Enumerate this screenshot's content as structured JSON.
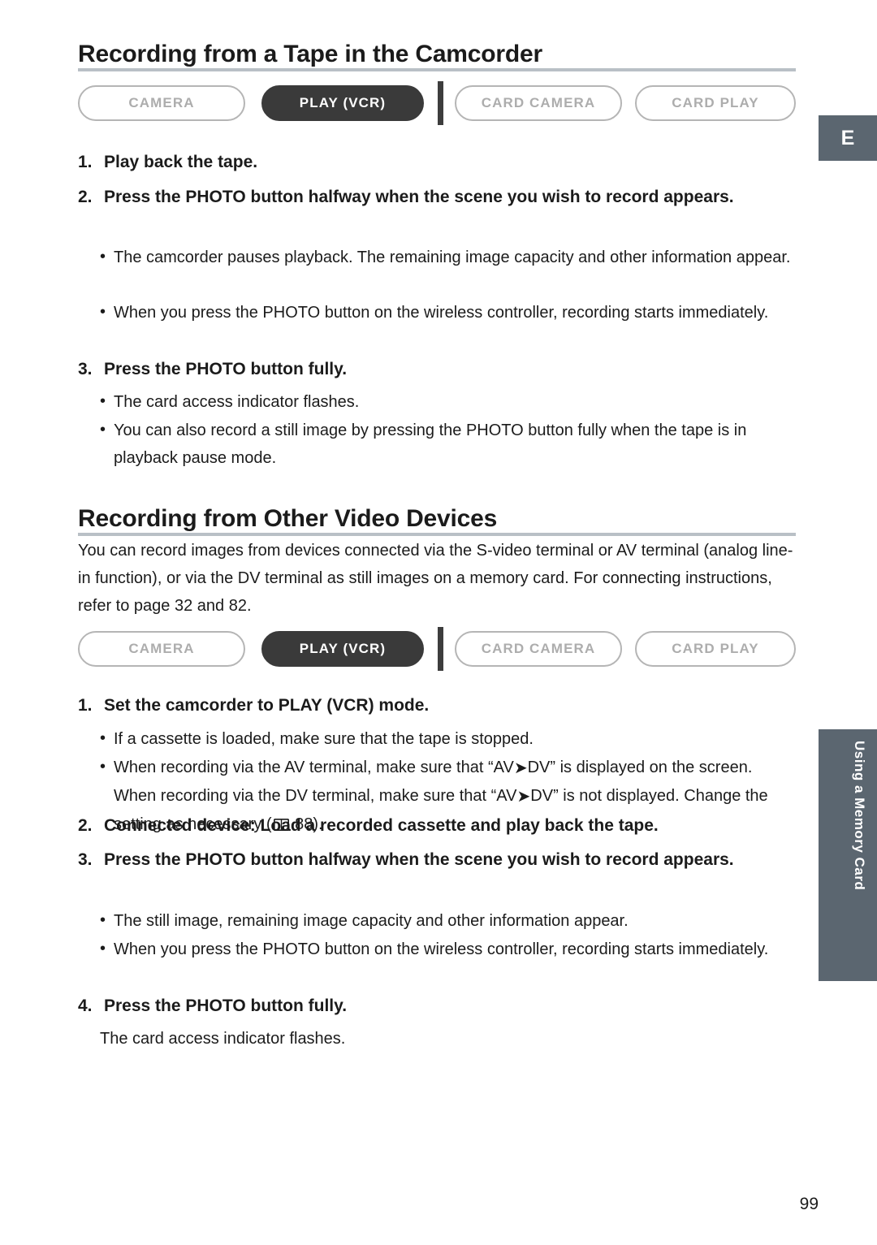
{
  "page": {
    "number": "99",
    "lang_tab": "E",
    "chapter_tab": "Using a Memory Card"
  },
  "section1": {
    "title": "Recording from a Tape in the Camcorder",
    "modes": [
      {
        "label": "CAMERA",
        "state": "inactive"
      },
      {
        "label": "PLAY (VCR)",
        "state": "active"
      },
      {
        "label": "CARD CAMERA",
        "state": "inactive"
      },
      {
        "label": "CARD PLAY",
        "state": "inactive"
      }
    ],
    "steps": [
      {
        "num": "1.",
        "text": "Play back the tape."
      },
      {
        "num": "2.",
        "text": "Press the PHOTO button halfway when the scene you wish to record appears."
      },
      {
        "num": "3.",
        "text": "Press the PHOTO button fully."
      }
    ],
    "bullets_after_step2": [
      "The camcorder pauses playback. The remaining image capacity and other information appear.",
      "When you press the PHOTO button on the wireless controller, recording starts immediately."
    ],
    "bullets_after_step3": [
      "The card access indicator flashes.",
      "You can also record a still image by pressing the PHOTO button fully when the tape is in playback pause mode."
    ]
  },
  "section2": {
    "title": "Recording from Other Video Devices",
    "intro": "You can record images from devices connected via the S-video terminal or AV terminal (analog line-in function), or via the DV terminal as still images on a memory card. For connecting instructions, refer to page 32 and 82.",
    "modes": [
      {
        "label": "CAMERA",
        "state": "inactive"
      },
      {
        "label": "PLAY (VCR)",
        "state": "active"
      },
      {
        "label": "CARD CAMERA",
        "state": "inactive"
      },
      {
        "label": "CARD PLAY",
        "state": "inactive"
      }
    ],
    "steps": [
      {
        "num": "1.",
        "text": "Set the camcorder to PLAY (VCR) mode."
      },
      {
        "num": "2.",
        "text": "Connected device: Load a recorded cassette and play back the tape."
      },
      {
        "num": "3.",
        "text": "Press the PHOTO button halfway when the scene you wish to record appears."
      },
      {
        "num": "4.",
        "text": "Press the PHOTO button fully."
      }
    ],
    "bullets_after_step1": [
      "If a cassette is loaded, make sure that the tape is stopped.",
      "When recording via the AV terminal, make sure that “AV➔DV” is displayed on the screen. When recording via the DV terminal, make sure that “AV➔DV” is not displayed. Change the setting as necessary (  88)."
    ],
    "bullets_after_step3": [
      "The still image, remaining image capacity and other information appear.",
      "When you press the PHOTO button on the wireless controller, recording starts immediately."
    ],
    "text_after_step4": "The card access indicator flashes."
  },
  "icons": {
    "book": "book-icon",
    "arrow": "right-arrow-icon"
  }
}
